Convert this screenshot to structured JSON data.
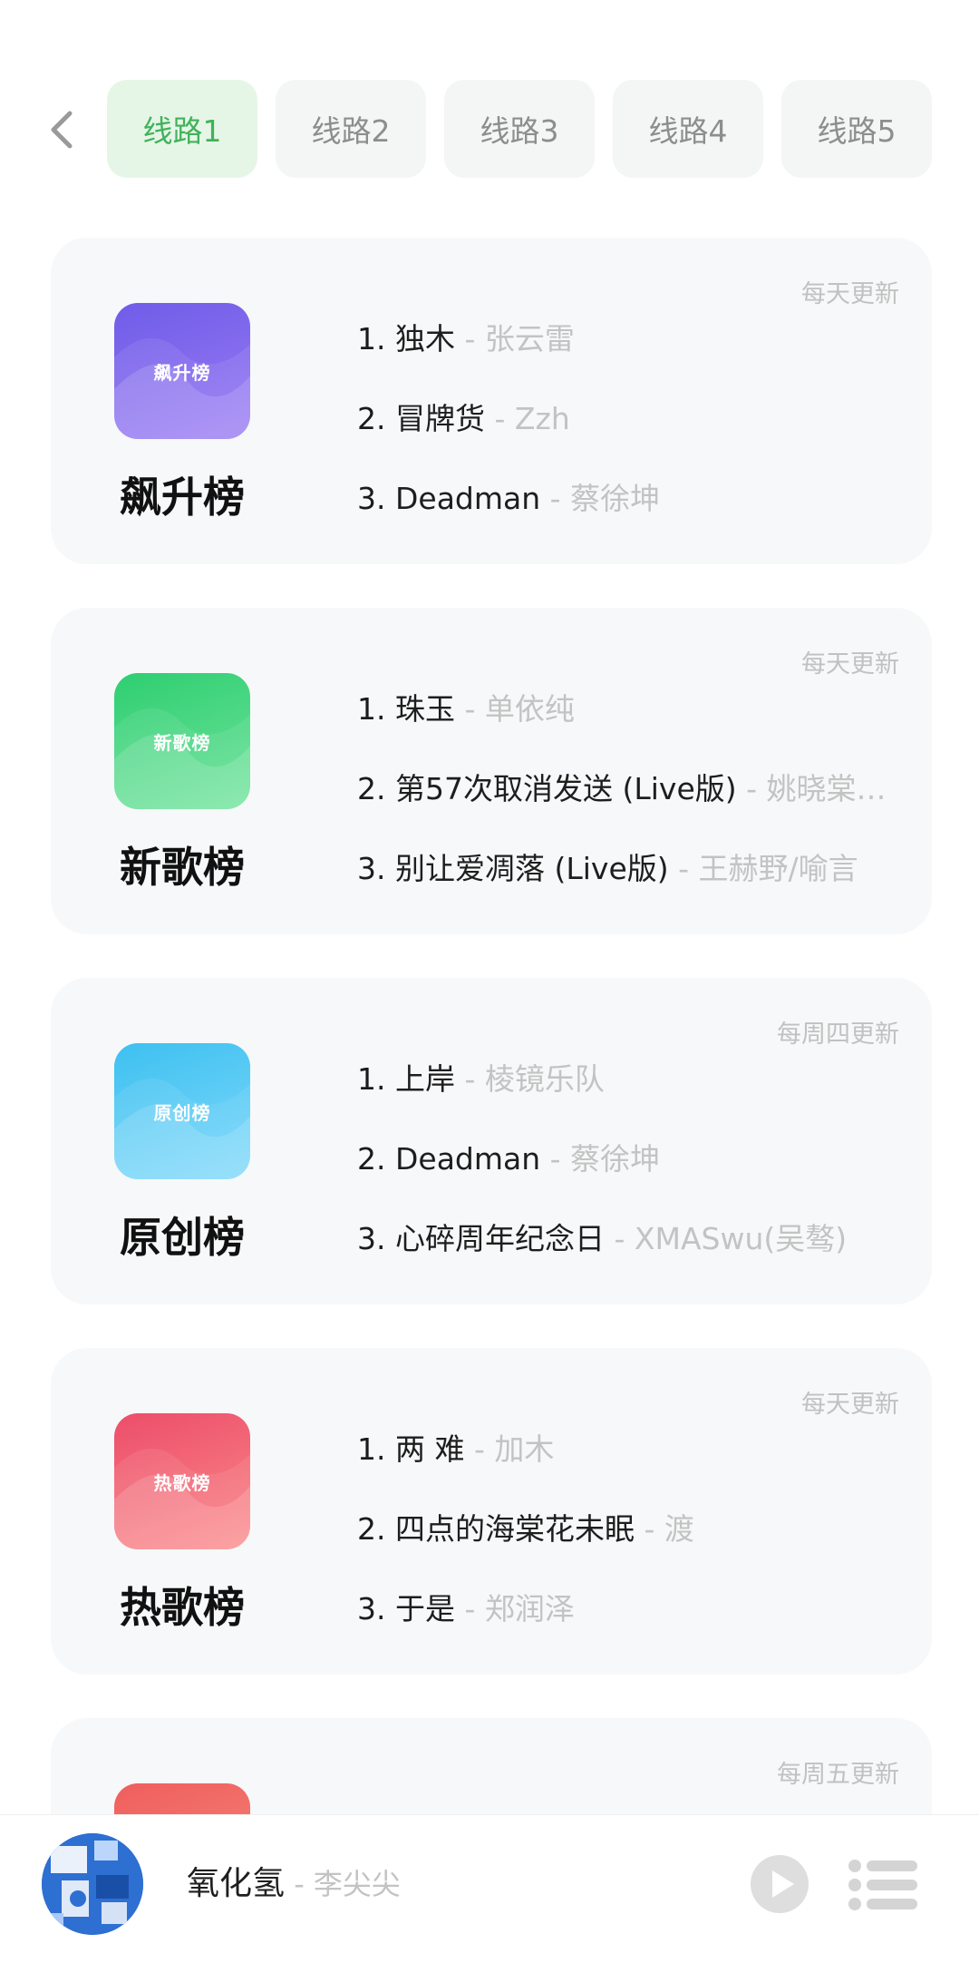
{
  "routes": [
    "线路1",
    "线路2",
    "线路3",
    "线路4",
    "线路5"
  ],
  "active_route": 0,
  "charts": [
    {
      "name": "飙升榜",
      "cover_text": "飙升榜",
      "frequency": "每天更新",
      "songs": [
        {
          "rank": "1.",
          "title": "独木",
          "artist": "张云雷"
        },
        {
          "rank": "2.",
          "title": "冒牌货",
          "artist": "Zzh"
        },
        {
          "rank": "3.",
          "title": "Deadman",
          "artist": "蔡徐坤"
        }
      ]
    },
    {
      "name": "新歌榜",
      "cover_text": "新歌榜",
      "frequency": "每天更新",
      "songs": [
        {
          "rank": "1.",
          "title": "珠玉",
          "artist": "单依纯"
        },
        {
          "rank": "2.",
          "title": "第57次取消发送 (Live版)",
          "artist": "姚晓棠…"
        },
        {
          "rank": "3.",
          "title": "别让爱凋落 (Live版)",
          "artist": "王赫野/喻言"
        }
      ]
    },
    {
      "name": "原创榜",
      "cover_text": "原创榜",
      "frequency": "每周四更新",
      "songs": [
        {
          "rank": "1.",
          "title": "上岸",
          "artist": "棱镜乐队"
        },
        {
          "rank": "2.",
          "title": "Deadman",
          "artist": "蔡徐坤"
        },
        {
          "rank": "3.",
          "title": "心碎周年纪念日",
          "artist": "XMASwu(吴骜)"
        }
      ]
    },
    {
      "name": "热歌榜",
      "cover_text": "热歌榜",
      "frequency": "每天更新",
      "songs": [
        {
          "rank": "1.",
          "title": "两 难",
          "artist": "加木"
        },
        {
          "rank": "2.",
          "title": "四点的海棠花未眠",
          "artist": "渡"
        },
        {
          "rank": "3.",
          "title": "于是",
          "artist": "郑润泽"
        }
      ]
    },
    {
      "name": "",
      "cover_text": "",
      "frequency": "每周五更新",
      "songs": []
    }
  ],
  "separator": " - ",
  "player": {
    "title": "氧化氢",
    "artist": "李尖尖"
  },
  "colors": {
    "accent_green": "#41b25a",
    "active_tab_bg": "#e5f6e7",
    "card_bg": "#f7f8f9",
    "muted_text": "#c3c3c3"
  },
  "icons": {
    "back": "chevron-left-icon",
    "play": "play-circle-icon",
    "playlist": "playlist-icon"
  }
}
